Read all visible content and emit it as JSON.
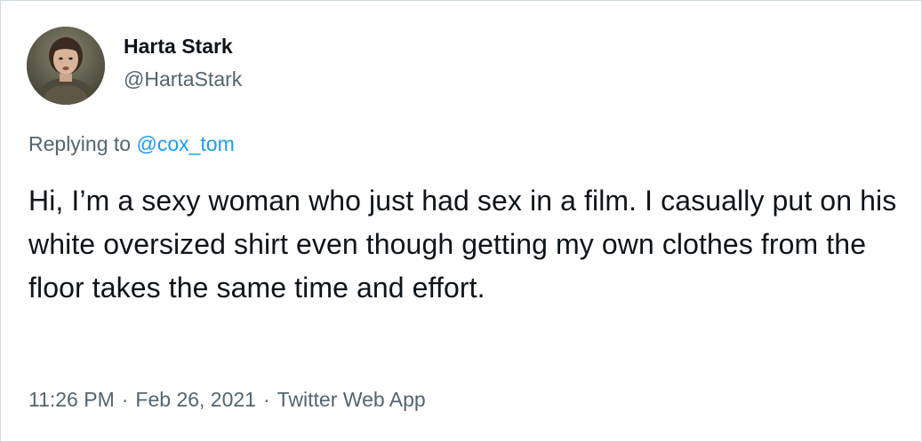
{
  "author": {
    "display_name": "Harta Stark",
    "handle": "@HartaStark"
  },
  "reply": {
    "prefix": "Replying to ",
    "to_handle": "@cox_tom"
  },
  "tweet": {
    "text": "Hi, I’m a sexy woman who just had sex in a film. I casually put on his white oversized shirt even though getting my own clothes from the floor takes the same time and effort."
  },
  "meta": {
    "time": "11:26 PM",
    "separator": "·",
    "date": "Feb 26, 2021",
    "source": "Twitter Web App"
  },
  "colors": {
    "text_primary": "#0f1419",
    "text_secondary": "#536471",
    "link": "#1d9bf0",
    "border": "#cfd9de"
  }
}
